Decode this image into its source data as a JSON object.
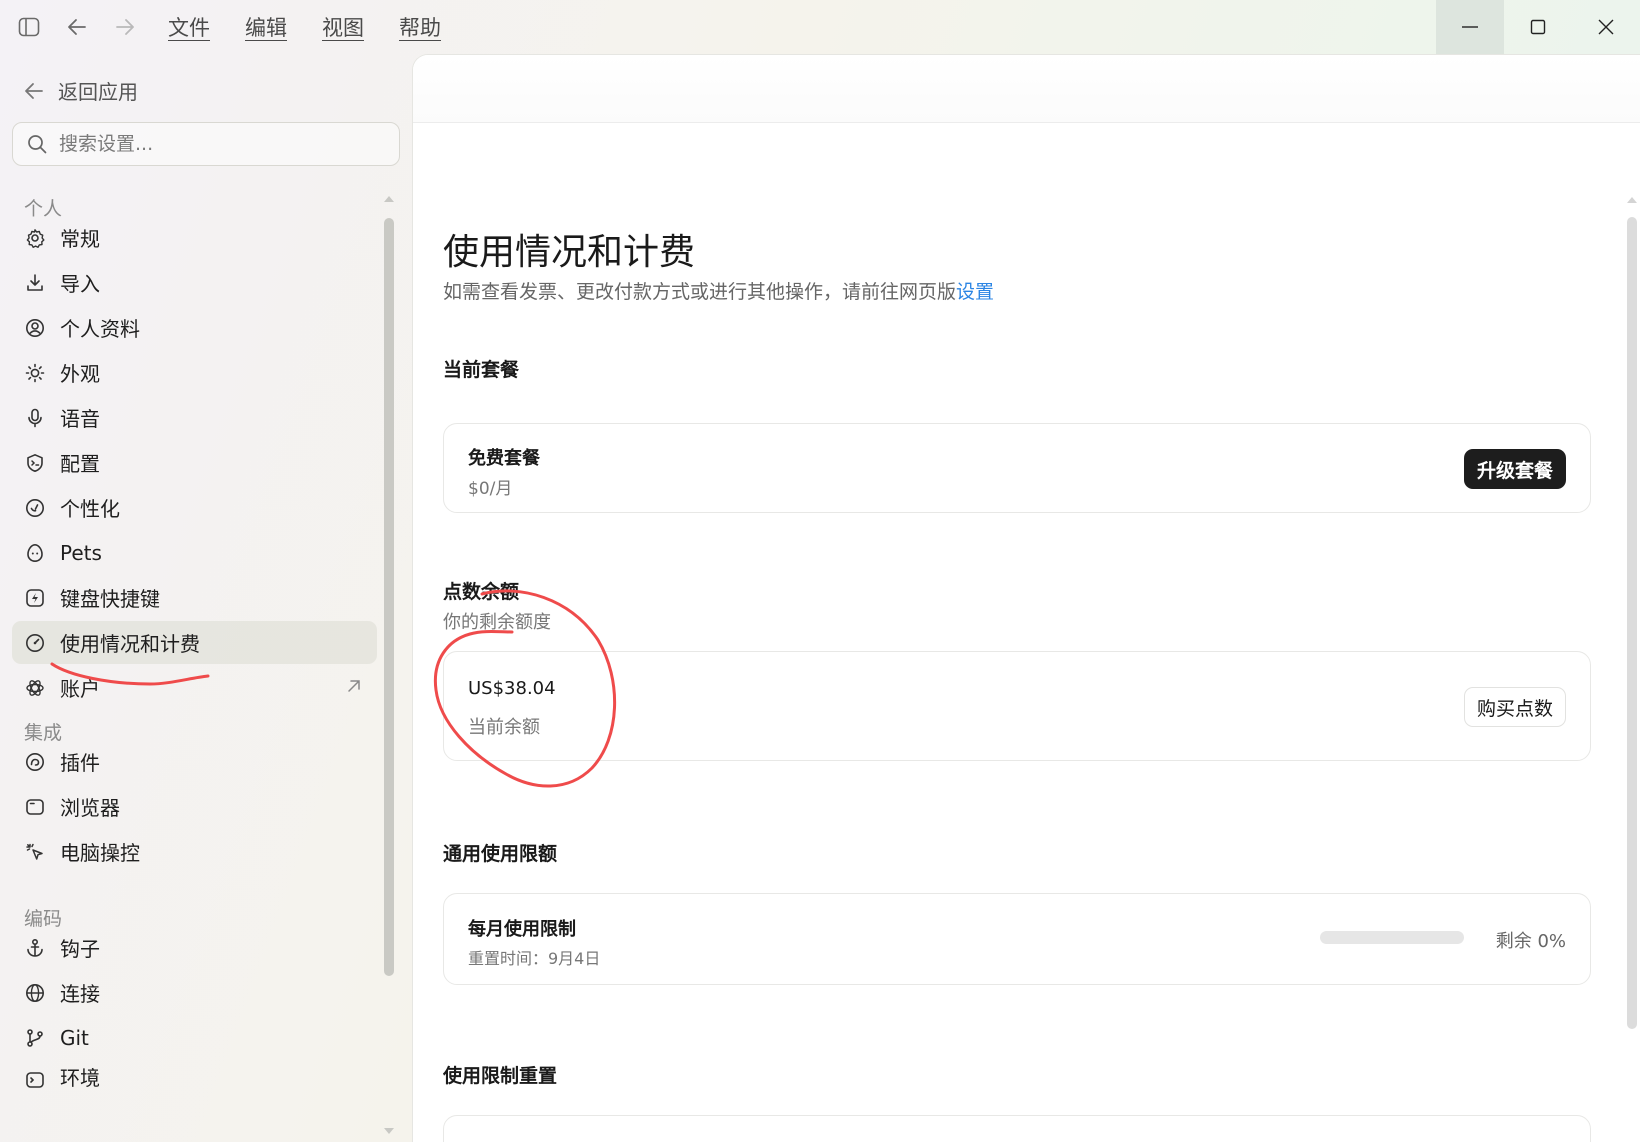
{
  "titlebar": {
    "menus": [
      "文件",
      "编辑",
      "视图",
      "帮助"
    ]
  },
  "sidebar": {
    "back_label": "返回应用",
    "search_placeholder": "搜索设置...",
    "groups": {
      "personal": "个人",
      "integration": "集成",
      "coding": "编码"
    },
    "items": {
      "general": "常规",
      "import": "导入",
      "profile": "个人资料",
      "appearance": "外观",
      "voice": "语音",
      "config": "配置",
      "personalization": "个性化",
      "pets": "Pets",
      "shortcuts": "键盘快捷键",
      "usage_billing": "使用情况和计费",
      "account": "账户",
      "plugins": "插件",
      "browser": "浏览器",
      "computer_control": "电脑操控",
      "hooks": "钩子",
      "connections": "连接",
      "git": "Git",
      "environment": "环境"
    }
  },
  "main": {
    "title": "使用情况和计费",
    "subtitle": "如需查看发票、更改付款方式或进行其他操作，请前往网页版",
    "subtitle_link": "设置",
    "current_plan": {
      "section_title": "当前套餐",
      "plan_name": "免费套餐",
      "plan_price": "$0/月",
      "upgrade_button": "升级套餐"
    },
    "credits": {
      "section_title": "点数余额",
      "section_sub": "你的剩余额度",
      "amount": "US$38.04",
      "amount_label": "当前余额",
      "buy_button": "购买点数"
    },
    "limits": {
      "section_title": "通用使用限额",
      "monthly_title": "每月使用限制",
      "reset_time": "重置时间：9月4日",
      "remaining": "剩余 0%",
      "remaining_fraction": 0
    },
    "reset": {
      "section_title": "使用限制重置"
    }
  },
  "colors": {
    "accent_link": "#2b85e4",
    "annotation_red": "#ef4b4b",
    "dark_button": "#1d1d1d"
  }
}
